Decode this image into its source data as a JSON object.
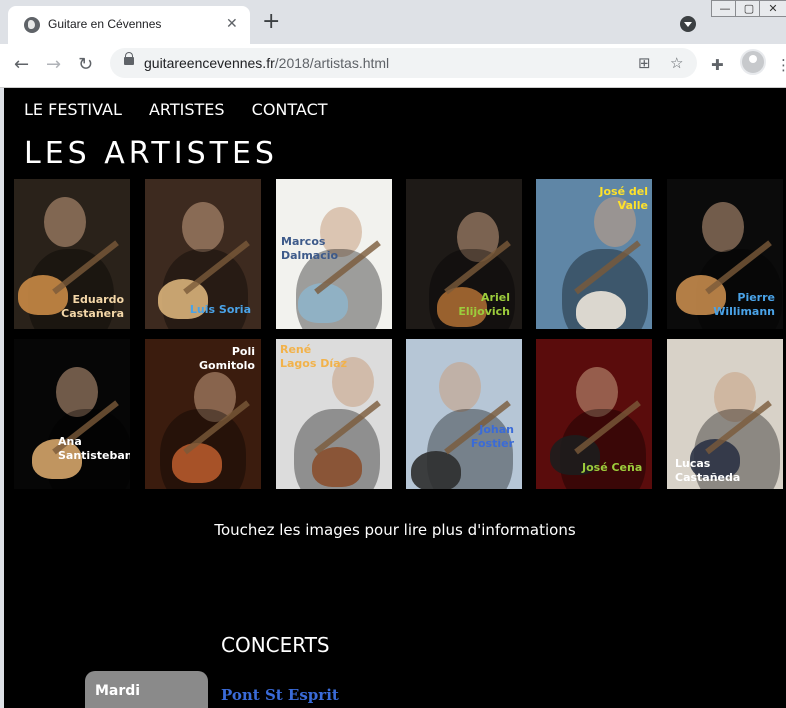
{
  "browser": {
    "tab_title": "Guitare en Cévennes",
    "tab_close": "✕",
    "new_tab": "+",
    "url_host": "guitareencevennes.fr",
    "url_path": "/2018/artistas.html",
    "window_minimize": "—",
    "window_maximize": "▢",
    "window_close": "✕",
    "back": "←",
    "forward": "→",
    "reload": "↻",
    "translate_icon": "⊞",
    "star_icon": "☆",
    "extensions_icon": "✚",
    "menu_icon": "⋮"
  },
  "menu": [
    "LE FESTIVAL",
    "ARTISTES",
    "CONTACT"
  ],
  "page_title": "LES ARTISTES",
  "artists": [
    {
      "name_line1": "Eduardo",
      "name_line2": "Castañera",
      "name_color": "#f4d7a8",
      "bg": "#2a221a",
      "accent": "#c98a46"
    },
    {
      "name_line1": "Luis Soria",
      "name_line2": "",
      "name_color": "#4aa3e8",
      "bg": "#3d2a1f",
      "accent": "#d9b27a"
    },
    {
      "name_line1": "Marcos",
      "name_line2": "Dalmacio",
      "name_color": "#3d5a8a",
      "bg": "#f2f2ee",
      "accent": "#8fb4c9"
    },
    {
      "name_line1": "Ariel",
      "name_line2": "Elijovich",
      "name_color": "#9ccc3c",
      "bg": "#1e1a17",
      "accent": "#a86a32"
    },
    {
      "name_line1": "José del",
      "name_line2": "Valle",
      "name_color": "#ffe22a",
      "bg": "#5f86a6",
      "accent": "#ece6da"
    },
    {
      "name_line1": "Pierre",
      "name_line2": "Willimann",
      "name_color": "#4aa3e8",
      "bg": "#0b0b0b",
      "accent": "#c58b4c"
    },
    {
      "name_line1": "Ana",
      "name_line2": "Santisteban",
      "name_color": "#ffffff",
      "bg": "#060606",
      "accent": "#d5a56a"
    },
    {
      "name_line1": "Poli",
      "name_line2": "Gomitolo",
      "name_color": "#ffffff",
      "bg": "#3b1c0e",
      "accent": "#b65a2c"
    },
    {
      "name_line1": "René",
      "name_line2": "Lagos Díaz",
      "name_color": "#f2b24a",
      "bg": "#dcdcdc",
      "accent": "#8a4f2e"
    },
    {
      "name_line1": "Johan",
      "name_line2": "Fostier",
      "name_color": "#3a6bd8",
      "bg": "#b6c6d6",
      "accent": "#2d2d2d"
    },
    {
      "name_line1": "José Ceña",
      "name_line2": "",
      "name_color": "#9ccc3c",
      "bg": "#5a0c0c",
      "accent": "#1d1d1d"
    },
    {
      "name_line1": "Lucas",
      "name_line2": "Castañeda",
      "name_color": "#ffffff",
      "bg": "#d8d2c8",
      "accent": "#2b3244"
    }
  ],
  "hint": "Touchez les images pour lire plus d'informations",
  "concerts": {
    "title": "CONCERTS",
    "day": "Mardi",
    "venue": "Pont St Esprit"
  }
}
